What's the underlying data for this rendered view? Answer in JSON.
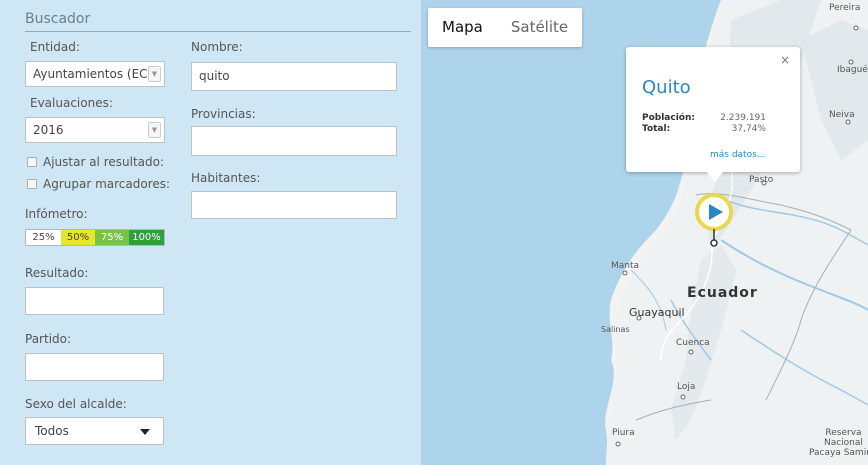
{
  "panel": {
    "title": "Buscador",
    "entidad_label": "Entidad:",
    "entidad_value": "Ayuntamientos (EC)",
    "evaluaciones_label": "Evaluaciones:",
    "evaluaciones_value": "2016",
    "ajustar_label": "Ajustar al resultado:",
    "agrupar_label": "Agrupar marcadores:",
    "infometro_label": "Infómetro:",
    "infometro": [
      "25%",
      "50%",
      "75%",
      "100%"
    ],
    "resultado_label": "Resultado:",
    "partido_label": "Partido:",
    "sexo_label": "Sexo del alcalde:",
    "sexo_value": "Todos",
    "nombre_label": "Nombre:",
    "nombre_value": "quito",
    "provincias_label": "Provincias:",
    "habitantes_label": "Habitantes:"
  },
  "map": {
    "tabs": [
      "Mapa",
      "Satélite"
    ],
    "places": {
      "pereira": "Pereira",
      "ibague": "Ibagué",
      "neiva": "Neiva",
      "pasto": "Pasto",
      "manta": "Manta",
      "ecuador": "Ecuador",
      "guayaquil": "Guayaquil",
      "salinas": "Salinas",
      "cuenca": "Cuenca",
      "loja": "Loja",
      "piura": "Piura",
      "reserva": [
        "Reserva",
        "Nacional",
        "Pacaya Samiria"
      ]
    },
    "popup": {
      "close": "×",
      "title": "Quito",
      "poblacion_label": "Población:",
      "poblacion_value": "2.239.191",
      "total_label": "Total:",
      "total_value": "37,74%",
      "more_link": "más datos..."
    },
    "colors": {
      "water": "#aed4ec",
      "land": "#f3f3f1",
      "pin": "#e8d84a",
      "play": "#2a86c6"
    }
  }
}
